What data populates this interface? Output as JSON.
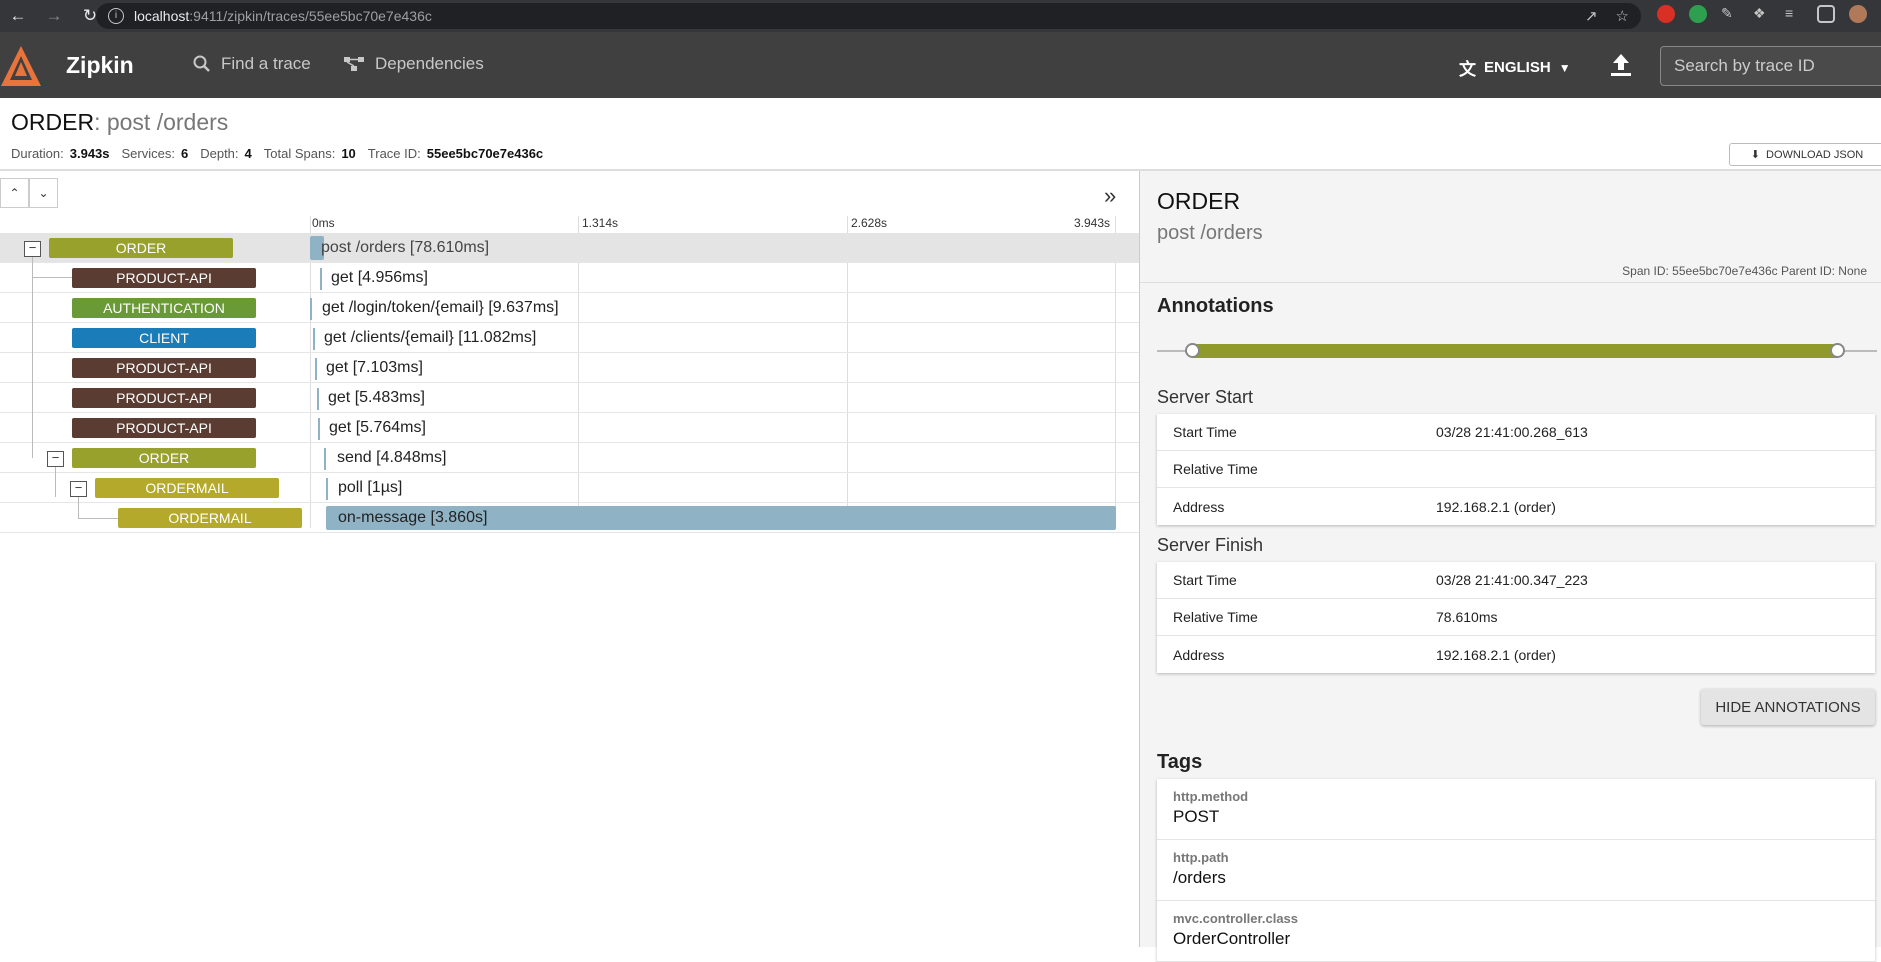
{
  "browser": {
    "url_host": "localhost",
    "url_path": ":9411/zipkin/traces/55ee5bc70e7e436c"
  },
  "app": {
    "brand": "Zipkin",
    "nav": {
      "find_trace": "Find a trace",
      "dependencies": "Dependencies"
    },
    "language": "ENGLISH",
    "search_placeholder": "Search by trace ID"
  },
  "trace": {
    "service": "ORDER",
    "name": ": post /orders",
    "summary": {
      "duration_label": "Duration:",
      "duration": "3.943s",
      "services_label": "Services:",
      "services": "6",
      "depth_label": "Depth:",
      "depth": "4",
      "spans_label": "Total Spans:",
      "spans": "10",
      "traceid_label": "Trace ID:",
      "trace_id": "55ee5bc70e7e436c"
    },
    "download_label": "DOWNLOAD JSON"
  },
  "timeline": {
    "ticks": [
      "0ms",
      "1.314s",
      "2.628s",
      "3.943s"
    ],
    "colors": {
      "ORDER": "#97a12c",
      "PRODUCT-API": "#5b3c32",
      "AUTHENTICATION": "#6a9a36",
      "CLIENT": "#1a7cb8",
      "ORDERMAIL": "#b4a92b"
    },
    "spans": [
      {
        "service": "ORDER",
        "label": "post /orders [78.610ms]"
      },
      {
        "service": "PRODUCT-API",
        "label": "get [4.956ms]"
      },
      {
        "service": "AUTHENTICATION",
        "label": "get /login/token/{email} [9.637ms]"
      },
      {
        "service": "CLIENT",
        "label": "get /clients/{email} [11.082ms]"
      },
      {
        "service": "PRODUCT-API",
        "label": "get [7.103ms]"
      },
      {
        "service": "PRODUCT-API",
        "label": "get [5.483ms]"
      },
      {
        "service": "PRODUCT-API",
        "label": "get [5.764ms]"
      },
      {
        "service": "ORDER",
        "label": "send [4.848ms]"
      },
      {
        "service": "ORDERMAIL",
        "label": "poll [1µs]"
      },
      {
        "service": "ORDERMAIL",
        "label": "on-message [3.860s]"
      }
    ]
  },
  "detail": {
    "service": "ORDER",
    "name": "post /orders",
    "ids": "Span ID: 55ee5bc70e7e436c  Parent ID: None",
    "annotations_title": "Annotations",
    "server_start": {
      "title": "Server Start",
      "rows": [
        {
          "k": "Start Time",
          "v": "03/28 21:41:00.268_613"
        },
        {
          "k": "Relative Time",
          "v": ""
        },
        {
          "k": "Address",
          "v": "192.168.2.1 (order)"
        }
      ]
    },
    "server_finish": {
      "title": "Server Finish",
      "rows": [
        {
          "k": "Start Time",
          "v": "03/28 21:41:00.347_223"
        },
        {
          "k": "Relative Time",
          "v": "78.610ms"
        },
        {
          "k": "Address",
          "v": "192.168.2.1 (order)"
        }
      ]
    },
    "hide_label": "HIDE ANNOTATIONS",
    "tags_title": "Tags",
    "tags": [
      {
        "k": "http.method",
        "v": "POST"
      },
      {
        "k": "http.path",
        "v": "/orders"
      },
      {
        "k": "mvc.controller.class",
        "v": "OrderController"
      }
    ]
  }
}
